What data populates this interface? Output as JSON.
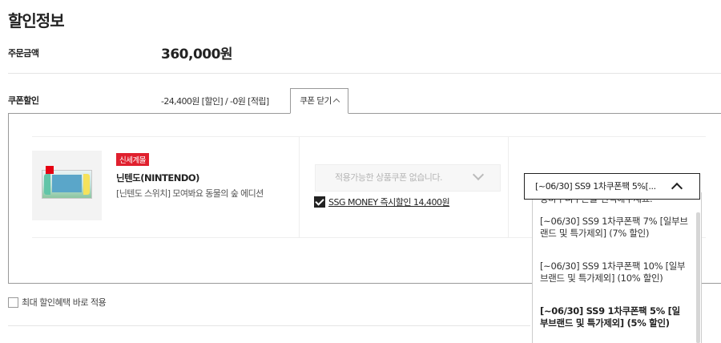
{
  "section": {
    "title": "할인정보"
  },
  "order": {
    "label": "주문금액",
    "amount": "360,000원"
  },
  "coupon": {
    "label": "쿠폰할인",
    "summary": "-24,400원 [할인] / -0원 [적립]",
    "toggle_label": "쿠폰 닫기"
  },
  "product": {
    "badge": "신세계몰",
    "brand": "닌텐도(NINTENDO)",
    "name": "[닌텐도 스위치] 모여봐요 동물의 숲 에디션",
    "thumb_icon": "nintendo-switch-product-image"
  },
  "product_coupon": {
    "placeholder": "적용가능한 상품쿠폰 없습니다."
  },
  "ssg_money": {
    "label": "SSG MONEY 즉시할인 14,400원",
    "checked": true
  },
  "cart_coupon": {
    "selected": "[~06/30] SS9 1차쿠폰팩 5%[...",
    "options": [
      {
        "text": "장바구니쿠폰을 선택해주세요.",
        "bold": false
      },
      {
        "text": "[~06/30] SS9 1차쿠폰팩 7% [일부브랜드 및 특가제외] (7% 할인)",
        "bold": false
      },
      {
        "text": "[~06/30] SS9 1차쿠폰팩 10% [일부브랜드 및 특가제외] (10% 할인)",
        "bold": false
      },
      {
        "text": "[~06/30] SS9 1차쿠폰팩 5% [일부브랜드 및 특가제외] (5% 할인)",
        "bold": true
      }
    ]
  },
  "apply_max": {
    "label": "최대 할인혜택 바로 적용",
    "checked": false
  },
  "colors": {
    "badge": "#e0202e",
    "border": "#999999",
    "text": "#222222"
  }
}
